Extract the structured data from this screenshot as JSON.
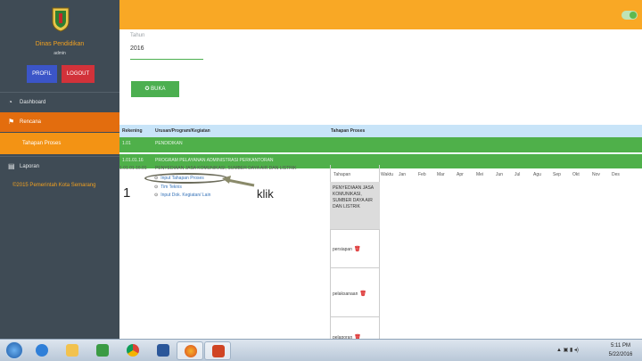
{
  "sidebar": {
    "title": "Dinas Pendidikan",
    "subtitle": "admin",
    "profil_label": "PROFIL",
    "logout_label": "LOGOUT",
    "nav": {
      "dashboard": "Dashboard",
      "rencana": "Rencana",
      "tahapan": "Tahapan Proses",
      "laporan": "Laporan"
    },
    "copyright": "©2015 Pemerintah Kota Semarang"
  },
  "form": {
    "tahun_label": "Tahun",
    "tahun_value": "2016",
    "buka_label": "BUKA"
  },
  "table": {
    "headers": {
      "rekening": "Rekening",
      "urusan": "Urusan/Program/Kegiatan",
      "tahapan": "Tahapan Proses"
    },
    "row1": {
      "kode": "1.01",
      "nama": "PENDIDIKAN"
    },
    "row2": {
      "kode": "1.01.01.16",
      "nama": "PROGRAM PELAYANAN ADMINISTRASI PERKANTORAN"
    },
    "row3": {
      "kode": "1.01.01.16.01",
      "nama": "PENYEDIAAN JASA KOMUNIKASI, SUMBER DAYA AIR DAN LISTRIK"
    },
    "actions": [
      "Input Tahapan Proses",
      "Tim Teknis",
      "Input Dok. Kegiatan/ Lain"
    ],
    "sub_headers": [
      "Tahapan",
      "Waktu",
      "Jan",
      "Feb",
      "Mar",
      "Apr",
      "Mei",
      "Jun",
      "Jul",
      "Agu",
      "Sep",
      "Okt",
      "Nov",
      "Des"
    ],
    "label_box": "PENYEDIAAN JASA KOMUNIKASI, SUMBER DAYA AIR DAN LISTRIK",
    "stages": [
      "persiapan",
      "pelaksanaan",
      "pelaporan"
    ]
  },
  "annotations": {
    "step": "1",
    "klik": "klik"
  },
  "taskbar": {
    "time": "5:11 PM",
    "date": "5/22/2016",
    "apps": [
      "ie",
      "explorer",
      "media",
      "chrome",
      "word",
      "firefox",
      "powerpoint"
    ]
  }
}
